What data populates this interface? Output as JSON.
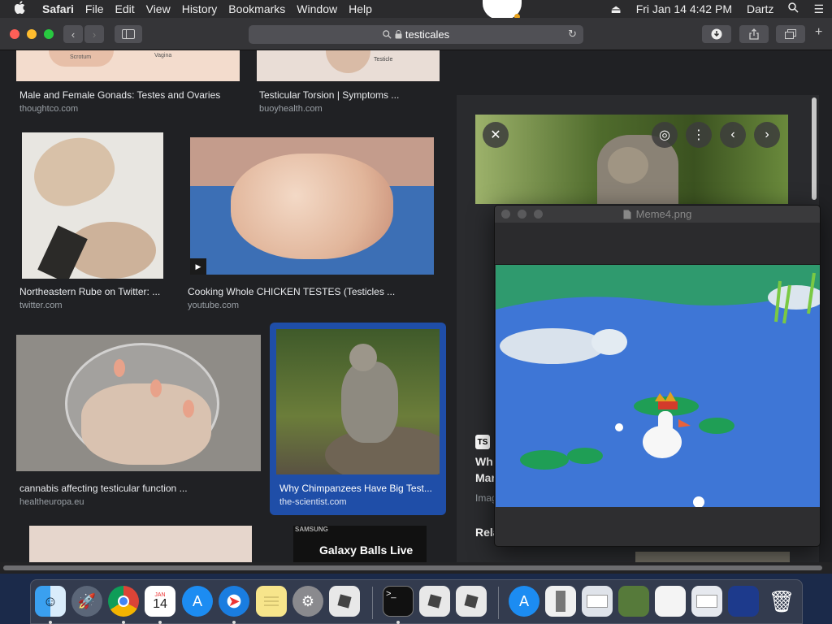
{
  "menubar": {
    "apple": "",
    "items": [
      "Safari",
      "File",
      "Edit",
      "View",
      "History",
      "Bookmarks",
      "Window",
      "Help"
    ],
    "clock": "Fri Jan 14  4:42 PM",
    "user": "Dartz"
  },
  "toolbar": {
    "address": "testicales"
  },
  "results": [
    {
      "caption": "Male and Female Gonads: Testes and Ovaries",
      "source": "thoughtco.com"
    },
    {
      "caption": "Testicular Torsion | Symptoms ...",
      "source": "buoyhealth.com"
    },
    {
      "caption": "Northeastern Rube on Twitter: ...",
      "source": "twitter.com"
    },
    {
      "caption": "Cooking Whole CHICKEN TESTES (Testicles ...",
      "source": "youtube.com"
    },
    {
      "caption": "cannabis affecting testicular function ...",
      "source": "healtheuropa.eu"
    },
    {
      "caption": "Why Chimpanzees Have Big Test...",
      "source": "the-scientist.com"
    }
  ],
  "thumb_labels": {
    "scrotum": "Scrotum",
    "vagina": "Vagina",
    "testicle": "Testicle",
    "samsung": "SAMSUNG",
    "galaxy": "Galaxy Balls  Live"
  },
  "panel": {
    "badge": "TS",
    "title_frag1": "Wh",
    "title_frag2": "Mar",
    "image_frag": "Imag",
    "related_frag": "Rela"
  },
  "preview": {
    "filename": "Meme4.png"
  },
  "dock": {
    "calendar_month": "JAN",
    "calendar_day": "14"
  }
}
